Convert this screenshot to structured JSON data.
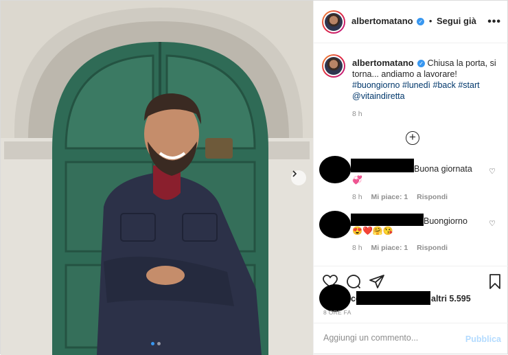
{
  "post": {
    "username": "albertomatano",
    "follow_label": "Segui già",
    "separator": "•",
    "more_icon": "more-horizontal-icon",
    "caption_text": "Chiusa la porta, si torna... andiamo a lavorare!",
    "hashtags": [
      "#buongiorno",
      "#lunedì",
      "#back",
      "#start"
    ],
    "mention": "@vitaindiretta",
    "caption_time": "8 h"
  },
  "comments": [
    {
      "text": "Buona giornata",
      "emoji": "💞",
      "time": "8 h",
      "likes": "Mi piace: 1",
      "reply": "Rispondi"
    },
    {
      "text": "Buongiorno",
      "emoji": "😍❤️🤗😘",
      "time": "8 h",
      "likes": "Mi piace: 1",
      "reply": "Rispondi"
    }
  ],
  "likes": {
    "prefix": "ce",
    "suffix": "altri 5.595"
  },
  "posted_ago": "8 ORE FA",
  "composer": {
    "placeholder": "Aggiungi un commento...",
    "publish_label": "Pubblica"
  },
  "carousel": {
    "count": 2,
    "active": 1
  },
  "colors": {
    "door_green": "#2f6b56",
    "verified_blue": "#3897f0",
    "publish_disabled": "#b3dbff"
  }
}
